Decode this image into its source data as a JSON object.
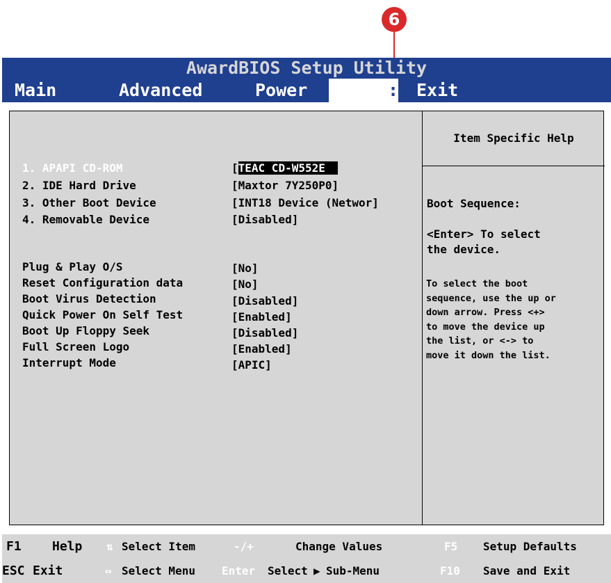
{
  "callout": {
    "number": "6"
  },
  "title": "AwardBIOS Setup Utility",
  "tabs": {
    "main": "Main",
    "advanced": "Advanced",
    "power": "Power",
    "boot_partial": ":",
    "exit": "Exit"
  },
  "boot_devices": [
    {
      "label": "1. APAPI CD-ROM",
      "value_open": "[",
      "value": "TEAC  CD-W552E"
    },
    {
      "label": "2. IDE Hard Drive",
      "value": "[Maxtor 7Y250P0]"
    },
    {
      "label": "3. Other Boot Device",
      "value": "[INT18 Device (Networ]"
    },
    {
      "label": "4. Removable Device",
      "value": "[Disabled]"
    }
  ],
  "settings": [
    {
      "label": "Plug & Play O/S",
      "value": "[No]"
    },
    {
      "label": "Reset Configuration data",
      "value": "[No]"
    },
    {
      "label": "Boot Virus Detection",
      "value": "[Disabled]"
    },
    {
      "label": "Quick Power On Self Test",
      "value": "[Enabled]"
    },
    {
      "label": "Boot Up Floppy Seek",
      "value": "[Disabled]"
    },
    {
      "label": "Full Screen Logo",
      "value": "[Enabled]"
    },
    {
      "label": "Interrupt Mode",
      "value": "[APIC]"
    }
  ],
  "help": {
    "title": "Item Specific Help",
    "line1": "Boot Sequence:",
    "line2": "<Enter> To select",
    "line3": "the device.",
    "small": [
      "To select the boot",
      "sequence, use the up or",
      "down arrow.  Press <+>",
      "to move the device up",
      "the list, or <-> to",
      "move it down the list."
    ]
  },
  "footer": {
    "row1": {
      "k1": "F1",
      "k1_text": "Help",
      "arrows_icon": "updown-arrows-icon",
      "k2_text": "Select Item",
      "k3": "-/+",
      "k3_text": "Change  Values",
      "k4": "F5",
      "k4_text": "Setup Defaults"
    },
    "row2": {
      "k1": "ESC",
      "k1_text": "Exit",
      "arrows_icon": "leftright-arrows-icon",
      "k2_text": "Select Menu",
      "k3": "Enter",
      "k3_text": "Select",
      "k3b": "Sub-Menu",
      "k4": "F10",
      "k4_text": "Save and Exit"
    }
  },
  "colors": {
    "menu_blue": "#1f3f8f",
    "panel_gray": "#d6d6d6",
    "callout_red": "#d9292b"
  }
}
